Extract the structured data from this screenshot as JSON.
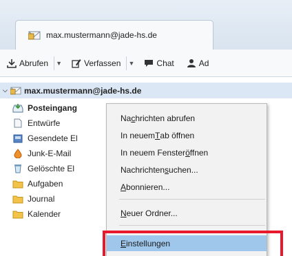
{
  "tab": {
    "label": "max.mustermann@jade-hs.de",
    "icon": "mail-account-icon"
  },
  "toolbar": {
    "abrufen": "Abrufen",
    "verfassen": "Verfassen",
    "chat": "Chat",
    "ad": "Ad"
  },
  "account": {
    "label": "max.mustermann@jade-hs.de"
  },
  "folders": [
    {
      "label": "Posteingang",
      "icon": "inbox-icon"
    },
    {
      "label": "Entwürfe",
      "icon": "drafts-icon"
    },
    {
      "label": "Gesendete El",
      "icon": "sent-icon"
    },
    {
      "label": "Junk-E-Mail",
      "icon": "junk-icon"
    },
    {
      "label": "Gelöschte El",
      "icon": "trash-icon"
    },
    {
      "label": "Aufgaben",
      "icon": "folder-icon"
    },
    {
      "label": "Journal",
      "icon": "folder-icon"
    },
    {
      "label": "Kalender",
      "icon": "folder-icon"
    }
  ],
  "menu": {
    "items": [
      {
        "pre": "Na",
        "u": "c",
        "post": "hrichten abrufen"
      },
      {
        "pre": "In neuem ",
        "u": "T",
        "post": "ab öffnen"
      },
      {
        "pre": "In neuem Fenster ",
        "u": "ö",
        "post": "ffnen"
      },
      {
        "pre": "Nachrichten ",
        "u": "s",
        "post": "uchen..."
      },
      {
        "pre": "",
        "u": "A",
        "post": "bonnieren..."
      },
      {
        "pre": "",
        "u": "N",
        "post": "euer Ordner..."
      },
      {
        "pre": "",
        "u": "E",
        "post": "instellungen"
      }
    ]
  },
  "colors": {
    "highlight": "#e8192c",
    "menu_active": "#9fc7ec",
    "account_row": "#dbe7f4"
  }
}
